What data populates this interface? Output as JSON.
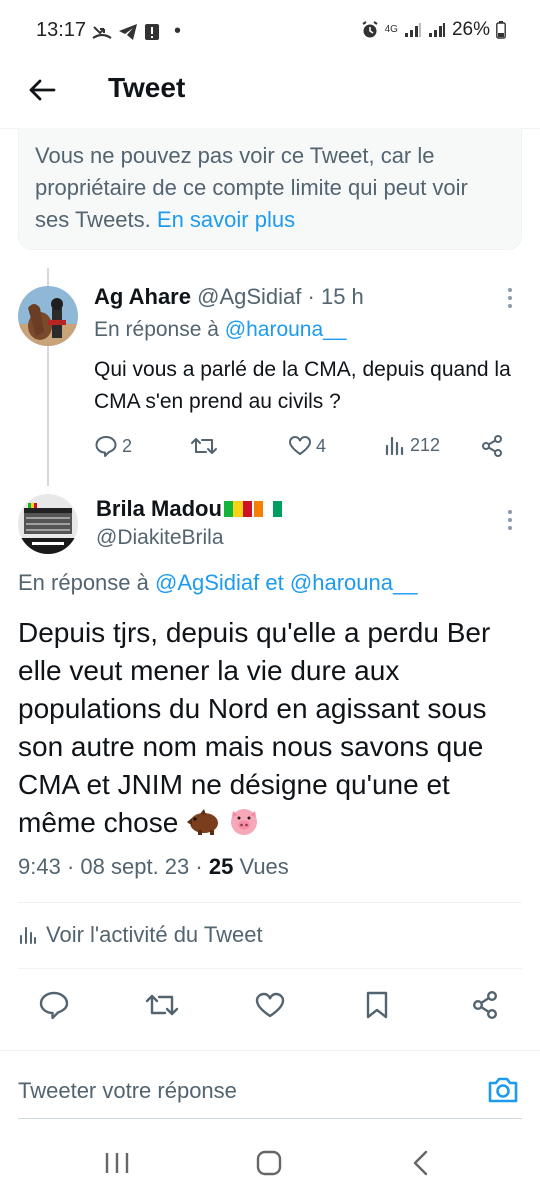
{
  "status_bar": {
    "time": "13:17",
    "dot": "•",
    "battery": "26%",
    "network": "4G"
  },
  "header": {
    "title": "Tweet"
  },
  "notice": {
    "text": "Vous ne pouvez pas voir ce Tweet, car le propriétaire de ce compte limite qui peut voir ses Tweets.",
    "link": "En savoir plus"
  },
  "reply_tweet": {
    "name": "Ag Ahare",
    "handle": "@AgSidiaf",
    "separator": "·",
    "time": "15 h",
    "reply_prefix": "En réponse à",
    "reply_to": "@harouna__",
    "text": "Qui vous a parlé de la CMA, depuis quand la CMA s'en prend au civils ?",
    "replies": "2",
    "retweets": "",
    "likes": "4",
    "views": "212"
  },
  "main_tweet": {
    "name": "Brila Madou",
    "flags": [
      "Mali",
      "Côte d'Ivoire"
    ],
    "handle": "@DiakiteBrila",
    "reply_prefix": "En réponse à",
    "reply_to_1": "@AgSidiaf",
    "reply_joiner": "et",
    "reply_to_2": "@harouna__",
    "text": "Depuis tjrs, depuis qu'elle a perdu Ber elle veut mener la vie dure aux populations du Nord en agissant sous son autre nom mais nous savons que CMA et JNIM ne désigne qu'une et même chose",
    "emojis": [
      "boar",
      "pig-face"
    ],
    "time": "9:43",
    "dot1": "·",
    "date": "08 sept. 23",
    "dot2": "·",
    "views_count": "25",
    "views_label": "Vues"
  },
  "activity": {
    "label": "Voir l'activité du Tweet"
  },
  "reply_box": {
    "placeholder": "Tweeter votre réponse"
  },
  "colors": {
    "accent": "#1d9bf0",
    "text": "#0f1419",
    "secondary": "#536471"
  }
}
